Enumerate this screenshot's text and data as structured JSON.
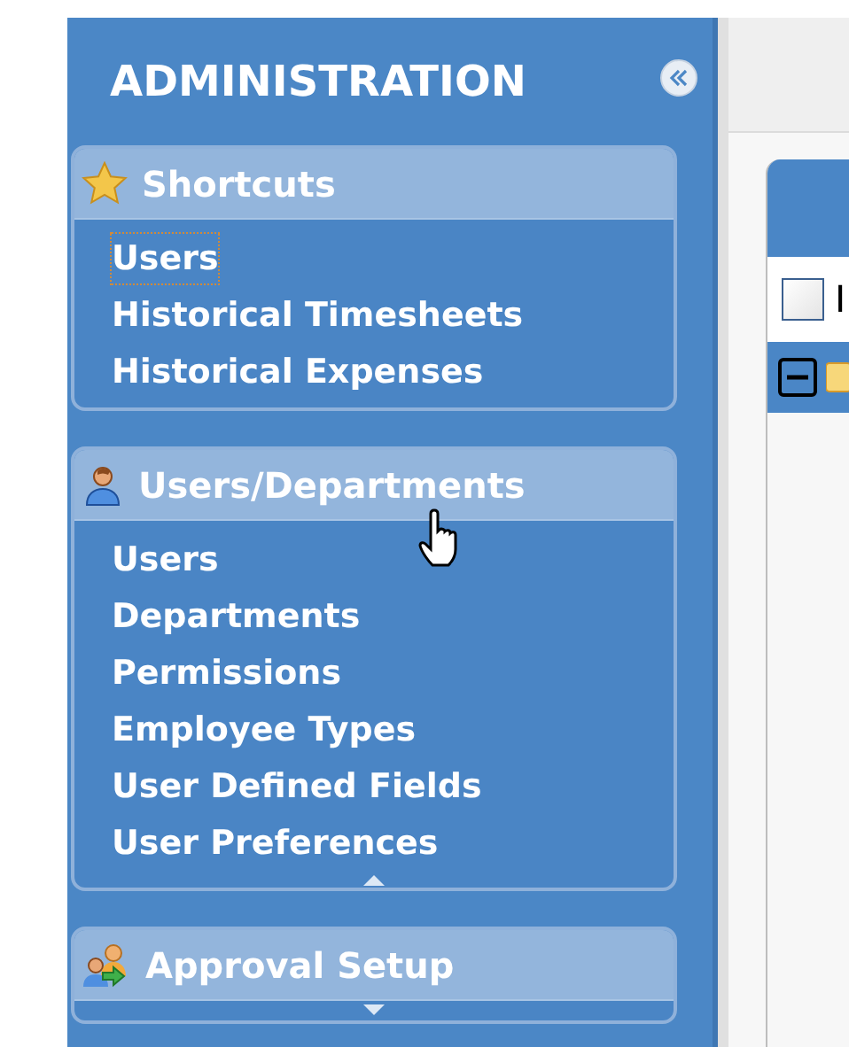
{
  "sidebar": {
    "title": "ADMINISTRATION",
    "sections": [
      {
        "title": "Shortcuts",
        "items": [
          {
            "label": "Users",
            "focused": true
          },
          {
            "label": "Historical Timesheets",
            "focused": false
          },
          {
            "label": "Historical Expenses",
            "focused": false
          }
        ]
      },
      {
        "title": "Users/Departments",
        "expanded": true,
        "items": [
          {
            "label": "Users",
            "focused": false
          },
          {
            "label": "Departments",
            "focused": false
          },
          {
            "label": "Permissions",
            "focused": false
          },
          {
            "label": "Employee Types",
            "focused": false
          },
          {
            "label": "User Defined Fields",
            "focused": false
          },
          {
            "label": "User Preferences",
            "focused": false
          }
        ]
      },
      {
        "title": "Approval Setup",
        "expanded": false
      }
    ]
  },
  "tree_panel": {
    "rows": [
      {
        "kind": "checkbox",
        "selected": false,
        "checked": false,
        "label": "I"
      },
      {
        "kind": "node",
        "selected": true,
        "expanded": true
      }
    ]
  }
}
